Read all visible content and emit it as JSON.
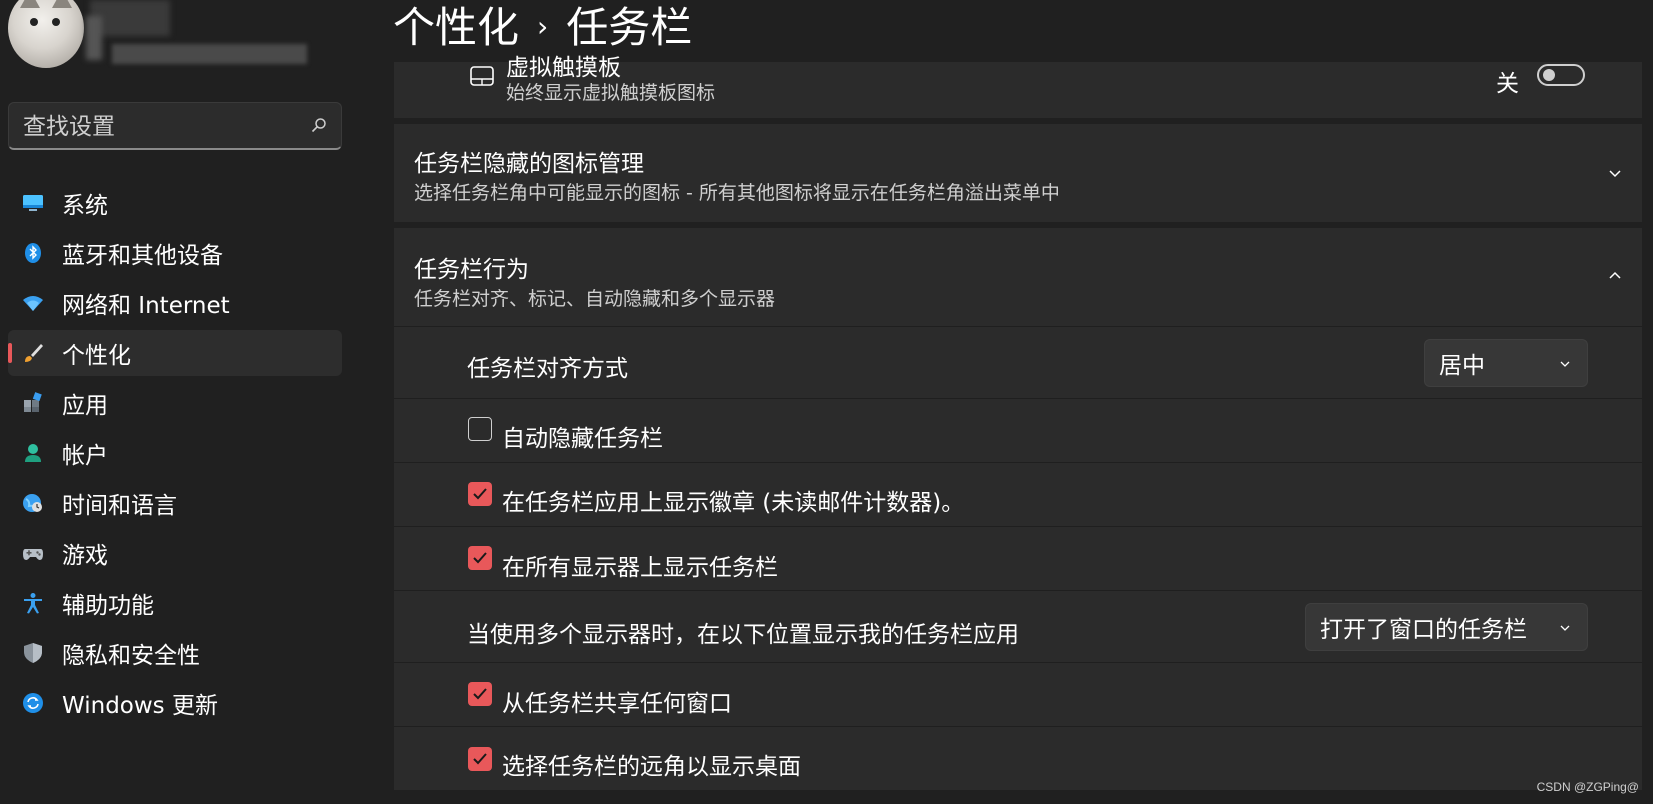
{
  "breadcrumb": {
    "parent": "个性化",
    "separator": "›",
    "current": "任务栏"
  },
  "search": {
    "placeholder": "查找设置"
  },
  "nav": [
    {
      "label": "系统",
      "icon": "monitor-icon",
      "active": false
    },
    {
      "label": "蓝牙和其他设备",
      "icon": "bluetooth-icon",
      "active": false
    },
    {
      "label": "网络和 Internet",
      "icon": "wifi-icon",
      "active": false
    },
    {
      "label": "个性化",
      "icon": "brush-icon",
      "active": true
    },
    {
      "label": "应用",
      "icon": "apps-icon",
      "active": false
    },
    {
      "label": "帐户",
      "icon": "person-icon",
      "active": false
    },
    {
      "label": "时间和语言",
      "icon": "globe-clock-icon",
      "active": false
    },
    {
      "label": "游戏",
      "icon": "gamepad-icon",
      "active": false
    },
    {
      "label": "辅助功能",
      "icon": "accessibility-icon",
      "active": false
    },
    {
      "label": "隐私和安全性",
      "icon": "shield-icon",
      "active": false
    },
    {
      "label": "Windows 更新",
      "icon": "update-icon",
      "active": false
    }
  ],
  "touchpad": {
    "title": "虚拟触摸板",
    "subtitle": "始终显示虚拟触摸板图标",
    "state_label": "关",
    "on": false
  },
  "hidden_icons": {
    "title": "任务栏隐藏的图标管理",
    "subtitle": "选择任务栏角中可能显示的图标 - 所有其他图标将显示在任务栏角溢出菜单中"
  },
  "behaviors": {
    "title": "任务栏行为",
    "subtitle": "任务栏对齐、标记、自动隐藏和多个显示器",
    "alignment": {
      "label": "任务栏对齐方式",
      "value": "居中"
    },
    "auto_hide": {
      "label": "自动隐藏任务栏",
      "checked": false
    },
    "badges": {
      "label": "在任务栏应用上显示徽章 (未读邮件计数器)。",
      "checked": true
    },
    "all_displays": {
      "label": "在所有显示器上显示任务栏",
      "checked": true
    },
    "multi_display": {
      "label": "当使用多个显示器时，在以下位置显示我的任务栏应用",
      "value": "打开了窗口的任务栏"
    },
    "share_window": {
      "label": "从任务栏共享任何窗口",
      "checked": true
    },
    "far_corner": {
      "label": "选择任务栏的远角以显示桌面",
      "checked": true
    }
  },
  "watermark": "CSDN @ZGPing@",
  "colors": {
    "accent": "#e8585a",
    "background": "#202020",
    "card": "#2b2b2b"
  }
}
